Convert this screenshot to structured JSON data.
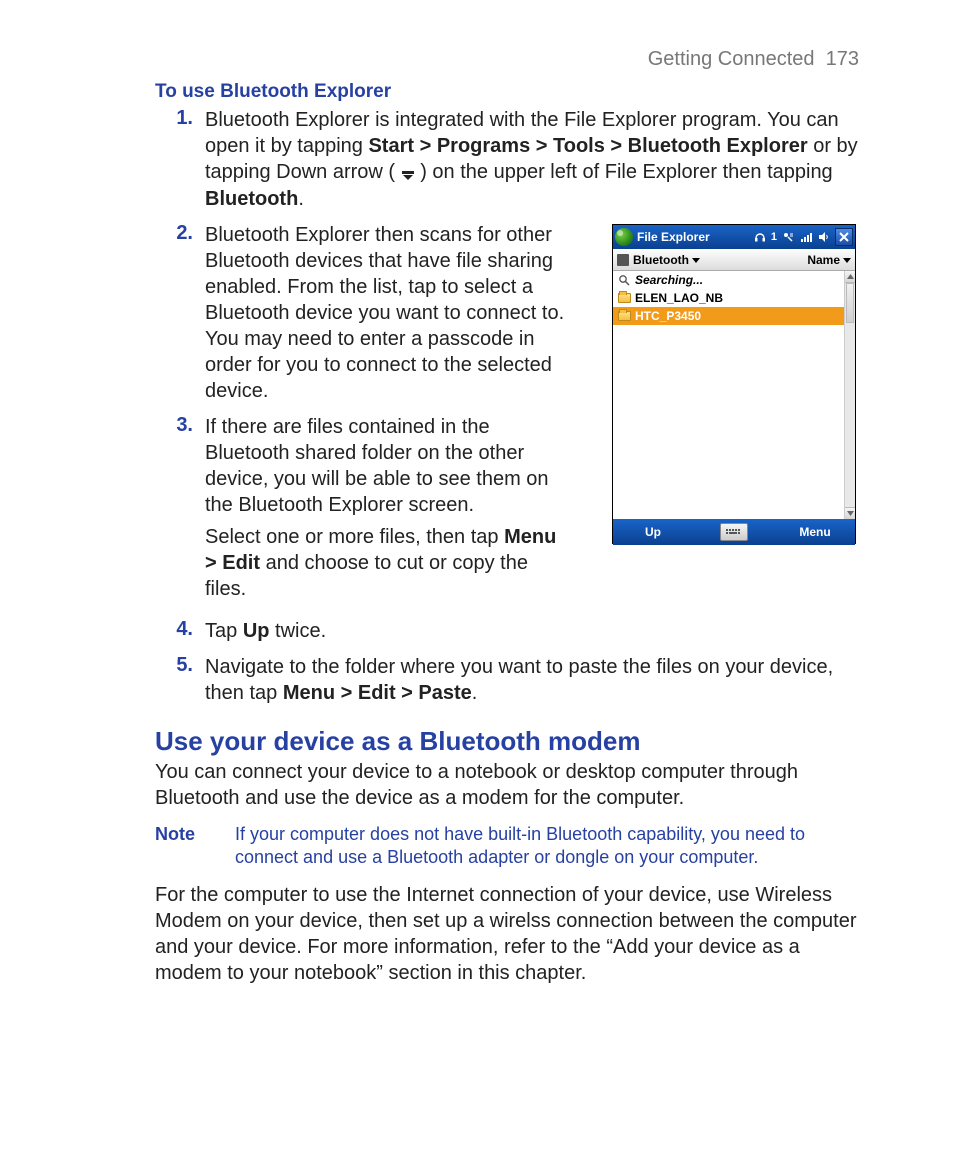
{
  "header": {
    "chapter": "Getting Connected",
    "page": "173"
  },
  "section1": {
    "title": "To use Bluetooth Explorer",
    "steps": [
      {
        "num": "1.",
        "t1": "Bluetooth Explorer is integrated with the File Explorer program. You can open it by tapping ",
        "b1": "Start > Programs > Tools > Bluetooth Explorer",
        "t2": " or by tapping Down arrow ( ",
        "t3": " ) on the upper left of File Explorer then tapping ",
        "b2": "Bluetooth",
        "t4": "."
      },
      {
        "num": "2.",
        "t1": "Bluetooth Explorer then scans for other Bluetooth devices that have file sharing enabled. From the list, tap to select a Bluetooth device you want to connect to. You may need to enter a passcode in order for you to connect to the selected device."
      },
      {
        "num": "3.",
        "p1": "If there are files contained in the Bluetooth shared folder on the other device, you will be able to see them on the Bluetooth Explorer screen.",
        "p2a": "Select one or more files, then tap ",
        "p2b": "Menu > Edit",
        "p2c": " and choose to cut or copy the files."
      },
      {
        "num": "4.",
        "t1": "Tap ",
        "b1": "Up",
        "t2": " twice."
      },
      {
        "num": "5.",
        "t1": "Navigate to the folder where you want to paste the files on your device, then tap ",
        "b1": "Menu > Edit > Paste",
        "t2": "."
      }
    ]
  },
  "device": {
    "title": "File Explorer",
    "status_num": "1",
    "path_label": "Bluetooth",
    "sort_label": "Name",
    "rows": {
      "searching": "Searching...",
      "item1": "ELEN_LAO_NB",
      "item2": "HTC_P3450"
    },
    "bottom": {
      "left": "Up",
      "right": "Menu"
    }
  },
  "section2": {
    "title": "Use your device as a Bluetooth modem",
    "intro": "You can connect your device to a notebook or desktop computer through Bluetooth and use the device as a modem for the computer.",
    "note_label": "Note",
    "note_text": "If your computer does not have built-in Bluetooth capability, you need to connect and use a Bluetooth adapter or dongle on your computer.",
    "para2": "For the computer to use the Internet connection of your device, use Wireless Modem on your device, then set up a wirelss connection between the computer and your device. For more information, refer to the “Add your device as a modem to your notebook” section in this chapter."
  }
}
